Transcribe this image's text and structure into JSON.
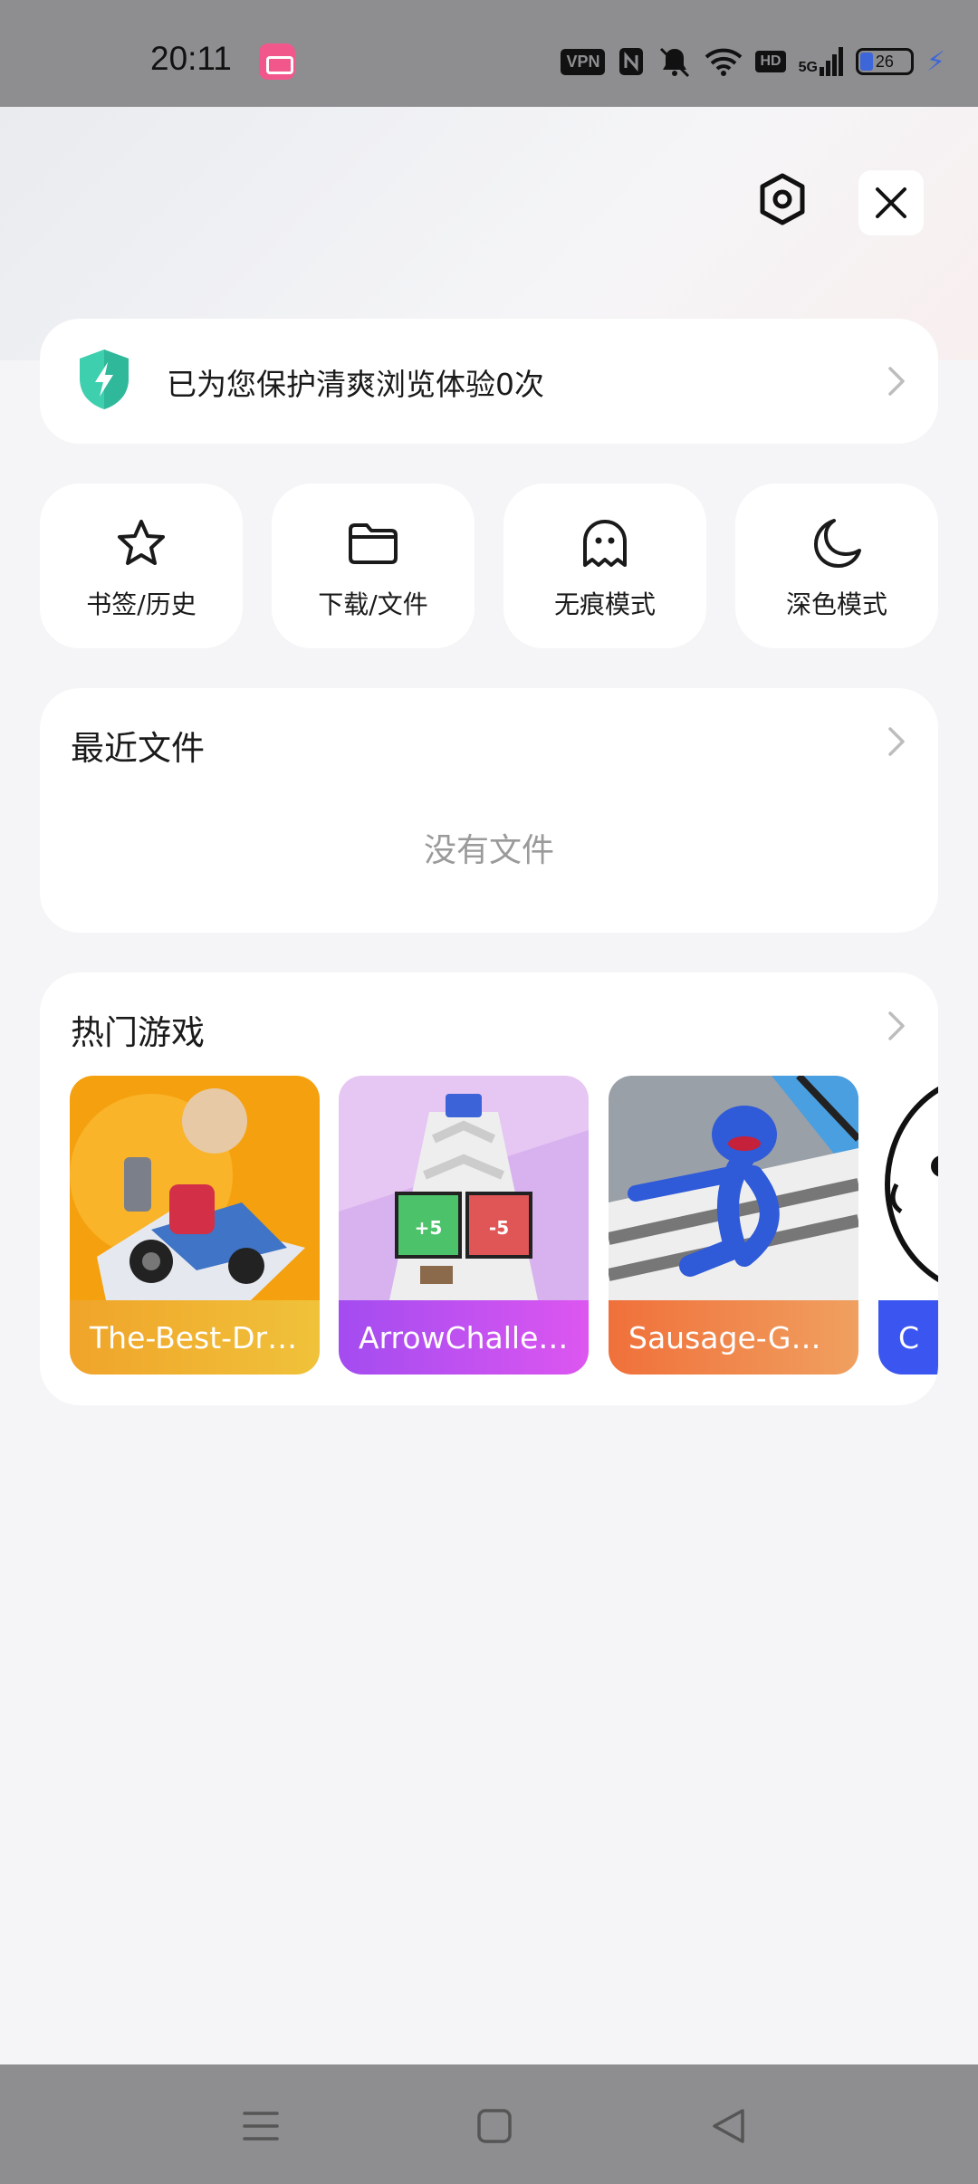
{
  "status_bar": {
    "time": "20:11",
    "vpn": "VPN",
    "hd": "HD",
    "network": "5G",
    "battery": "26"
  },
  "header": {
    "settings_icon": "settings-hexagon-icon",
    "close_icon": "close-icon"
  },
  "protection": {
    "text": "已为您保护清爽浏览体验0次",
    "icon": "shield-bolt-icon",
    "accent": "#3ecfae"
  },
  "quick_actions": [
    {
      "label": "书签/历史",
      "icon": "star-icon"
    },
    {
      "label": "下载/文件",
      "icon": "folder-icon"
    },
    {
      "label": "无痕模式",
      "icon": "ghost-icon"
    },
    {
      "label": "深色模式",
      "icon": "moon-icon"
    }
  ],
  "recent_files": {
    "title": "最近文件",
    "empty_text": "没有文件"
  },
  "hot_games": {
    "title": "热门游戏",
    "items": [
      {
        "name": "The-Best-Dri...",
        "color": "#f0b72f"
      },
      {
        "name": "ArrowChallen...",
        "color": "#c04cf0"
      },
      {
        "name": "Sausage-Guy...",
        "color": "#f07a3c"
      },
      {
        "name": "C",
        "color": "#3b55f0"
      }
    ]
  },
  "nav_bar": {
    "menu_icon": "menu-icon",
    "home_icon": "home-square-icon",
    "back_icon": "back-triangle-icon"
  }
}
